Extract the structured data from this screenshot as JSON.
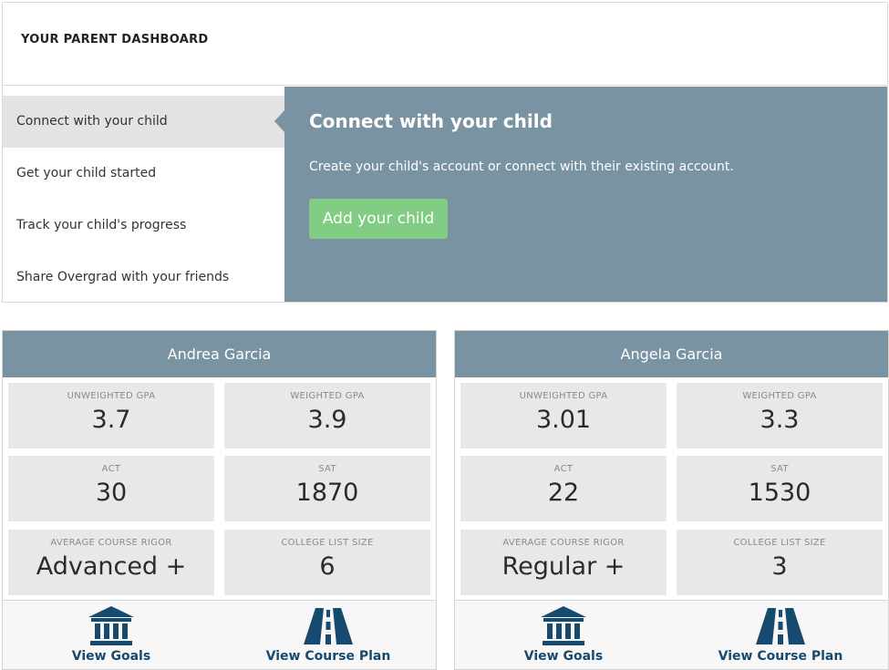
{
  "dashboard": {
    "title": "YOUR PARENT DASHBOARD",
    "nav": [
      {
        "label": "Connect with your child",
        "active": true
      },
      {
        "label": "Get your child started",
        "active": false
      },
      {
        "label": "Track your child's progress",
        "active": false
      },
      {
        "label": "Share Overgrad with your friends",
        "active": false
      }
    ],
    "panel": {
      "title": "Connect with your child",
      "description": "Create your child's account or connect with their existing account.",
      "button_label": "Add your child"
    }
  },
  "students": [
    {
      "name": "Andrea Garcia",
      "stats": [
        {
          "label": "UNWEIGHTED GPA",
          "value": "3.7"
        },
        {
          "label": "WEIGHTED GPA",
          "value": "3.9"
        },
        {
          "label": "ACT",
          "value": "30"
        },
        {
          "label": "SAT",
          "value": "1870"
        },
        {
          "label": "AVERAGE COURSE RIGOR",
          "value": "Advanced +"
        },
        {
          "label": "COLLEGE LIST SIZE",
          "value": "6"
        }
      ],
      "actions": {
        "goals": "View Goals",
        "course_plan": "View Course Plan"
      }
    },
    {
      "name": "Angela Garcia",
      "stats": [
        {
          "label": "UNWEIGHTED GPA",
          "value": "3.01"
        },
        {
          "label": "WEIGHTED GPA",
          "value": "3.3"
        },
        {
          "label": "ACT",
          "value": "22"
        },
        {
          "label": "SAT",
          "value": "1530"
        },
        {
          "label": "AVERAGE COURSE RIGOR",
          "value": "Regular +"
        },
        {
          "label": "COLLEGE LIST SIZE",
          "value": "3"
        }
      ],
      "actions": {
        "goals": "View Goals",
        "course_plan": "View Course Plan"
      }
    }
  ],
  "icons": {
    "goals": "institution-icon",
    "course_plan": "road-icon"
  },
  "colors": {
    "panel": "#7a93a2",
    "button": "#82cc83",
    "link": "#174a6f",
    "stat_bg": "#e8e8e8"
  }
}
